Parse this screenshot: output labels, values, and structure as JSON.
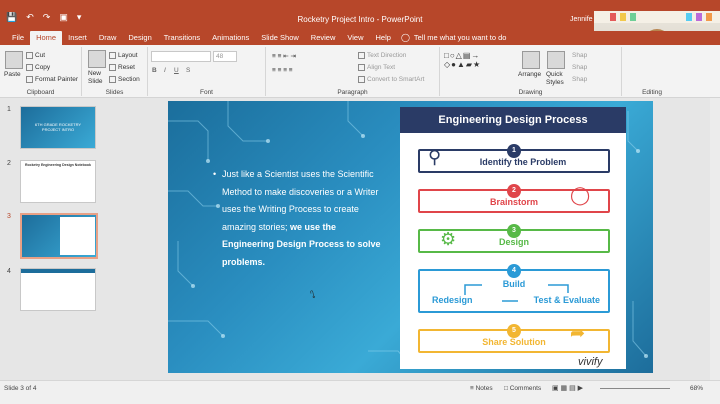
{
  "titlebar": {
    "doc_title": "Rocketry Project Intro  -  PowerPoint",
    "user": "Jennife"
  },
  "tabs": [
    "File",
    "Home",
    "Insert",
    "Draw",
    "Design",
    "Transitions",
    "Animations",
    "Slide Show",
    "Review",
    "View",
    "Help"
  ],
  "tell_me": "Tell me what you want to do",
  "ribbon": {
    "paste": "Paste",
    "cut": "Cut",
    "copy": "Copy",
    "format_painter": "Format Painter",
    "clipboard": "Clipboard",
    "new_slide_1": "New",
    "new_slide_2": "Slide",
    "layout": "Layout",
    "reset": "Reset",
    "section": "Section",
    "slides": "Slides",
    "font_size": "48",
    "font": "Font",
    "paragraph": "Paragraph",
    "text_direction": "Text Direction",
    "align_text": "Align Text",
    "convert_smartart": "Convert to SmartArt",
    "drawing": "Drawing",
    "arrange": "Arrange",
    "quick_styles_1": "Quick",
    "quick_styles_2": "Styles",
    "shape_1": "Shap",
    "shape_2": "Shap",
    "shape_3": "Shap",
    "editing": "Editing"
  },
  "thumbnails": [
    {
      "num": "1",
      "text": "6TH GRADE ROCKETRY PROJECT INTRO"
    },
    {
      "num": "2",
      "text": "Rocketry Engineering Design Notebook"
    },
    {
      "num": "3",
      "text": ""
    },
    {
      "num": "4",
      "text": ""
    }
  ],
  "slide": {
    "bullet_plain": "Just like a Scientist uses the Scientific Method to make discoveries or a Writer uses the Writing Process to create amazing stories;",
    "bullet_bold": "we use the Engineering Design Process to solve problems.",
    "panel_title": "Engineering Design Process",
    "steps": [
      {
        "num": "1",
        "label": "Identify the Problem"
      },
      {
        "num": "2",
        "label": "Brainstorm"
      },
      {
        "num": "3",
        "label": "Design"
      },
      {
        "num": "4",
        "build": "Build",
        "redesign": "Redesign",
        "test": "Test & Evaluate"
      },
      {
        "num": "5",
        "label": "Share Solution"
      }
    ],
    "brand": "vivify"
  },
  "status": {
    "slide_info": "Slide 3 of 4",
    "notes": "Notes",
    "comments": "Comments",
    "zoom": "68%"
  },
  "colors": {
    "accent": "#b7472a",
    "step1": "#2a3b66",
    "step2": "#e0454a",
    "step3": "#57b947",
    "step4": "#2b9ad6",
    "step5": "#f2b632"
  }
}
